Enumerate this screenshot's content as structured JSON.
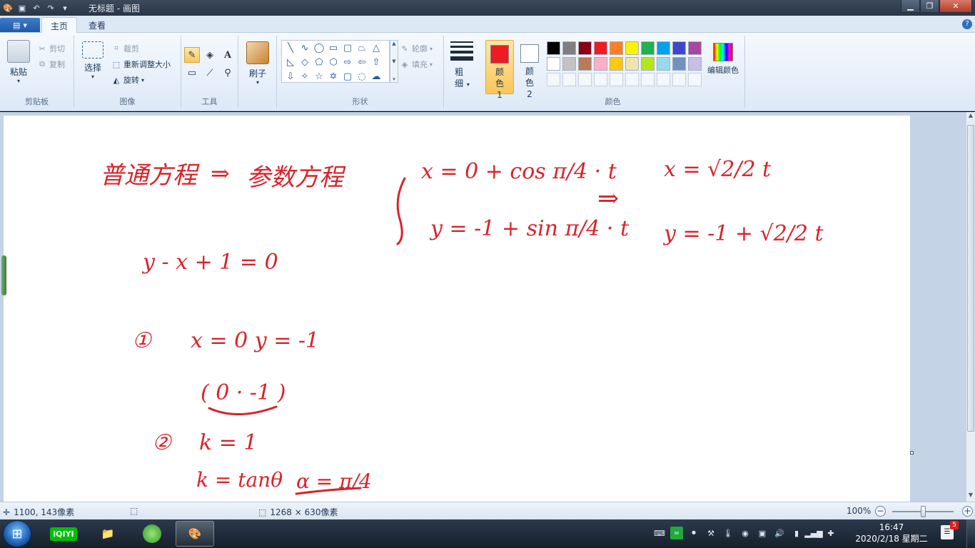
{
  "window": {
    "title": "无标题 - 画图"
  },
  "qat": {
    "icons": [
      "paint-app-icon",
      "save-icon",
      "undo-icon",
      "redo-icon",
      "customize-qat-icon"
    ]
  },
  "tabs": [
    {
      "label": "主页",
      "active": true
    },
    {
      "label": "查看",
      "active": false
    }
  ],
  "ribbon": {
    "clipboard": {
      "label": "剪贴板",
      "paste": "粘贴",
      "cut": "剪切",
      "copy": "复制"
    },
    "image": {
      "label": "图像",
      "select": "选择",
      "crop": "裁剪",
      "resize": "重新调整大小",
      "rotate": "旋转"
    },
    "tools": {
      "label": "工具"
    },
    "brushes": {
      "label": "刷子"
    },
    "shapes": {
      "label": "形状",
      "outline": "轮廓",
      "fill": "填充"
    },
    "size": {
      "label": "粗细"
    },
    "colors": {
      "label": "颜色",
      "color1": "颜色 1",
      "color2": "颜色 2",
      "color1_value": "#ed1c24",
      "color2_value": "#ffffff",
      "edit": "编辑颜色",
      "palette": [
        "#000000",
        "#7f7f7f",
        "#880015",
        "#ed1c24",
        "#ff7f27",
        "#fff200",
        "#22b14c",
        "#00a2e8",
        "#3f48cc",
        "#a349a4",
        "#ffffff",
        "#c3c3c3",
        "#b97a57",
        "#ffaec9",
        "#ffc90e",
        "#efe4b0",
        "#b5e61d",
        "#99d9ea",
        "#7092be",
        "#c8bfe7",
        "",
        "",
        "",
        "",
        "",
        "",
        "",
        "",
        "",
        ""
      ]
    }
  },
  "canvas": {
    "ink_color": "#d9232b",
    "handwriting": {
      "title_left": "普通方程",
      "arrow": "⇒",
      "title_right": "参数方程",
      "equation": "y - x + 1 = 0",
      "step1_label": "①",
      "step1": "x = 0   y = -1",
      "point": "( 0 · -1 )",
      "step2_label": "②",
      "step2_k": "k = 1",
      "step2_tan": "k = tanθ",
      "alpha": "α = π/4",
      "param_x": "x = 0 + cos π/4 · t",
      "param_y": "y = -1 + sin π/4 · t",
      "arrow2": "⇒",
      "final_x": "x = √2/2 t",
      "final_y": "y = -1 + √2/2 t"
    }
  },
  "status": {
    "cursor_pos": "1100, 143像素",
    "canvas_size": "1268 × 630像素",
    "zoom": "100%",
    "zoom_level": 1.0
  },
  "taskbar": {
    "apps": [
      "start-orb",
      "iqiyi-app",
      "file-explorer-app",
      "browser-app",
      "paint-app"
    ],
    "iqiyi_label": "iQIYI",
    "time": "16:47",
    "date": "2020/2/18 星期二",
    "notif_count": "5"
  }
}
